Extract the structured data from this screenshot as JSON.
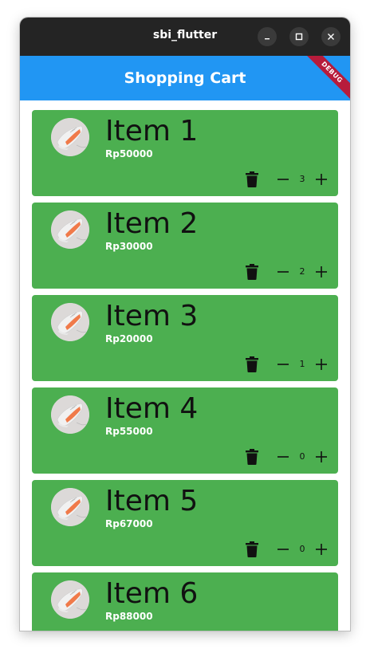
{
  "window": {
    "title": "sbi_flutter"
  },
  "appbar": {
    "title": "Shopping Cart",
    "debug_label": "DEBUG"
  },
  "colors": {
    "titlebar": "#242424",
    "appbar": "#2196f3",
    "card": "#4caf50",
    "debug_banner": "#b71c3c"
  },
  "cart": {
    "items": [
      {
        "name": "Item 1",
        "price": "Rp50000",
        "qty": "3"
      },
      {
        "name": "Item 2",
        "price": "Rp30000",
        "qty": "2"
      },
      {
        "name": "Item 3",
        "price": "Rp20000",
        "qty": "1"
      },
      {
        "name": "Item 4",
        "price": "Rp55000",
        "qty": "0"
      },
      {
        "name": "Item 5",
        "price": "Rp67000",
        "qty": "0"
      },
      {
        "name": "Item 6",
        "price": "Rp88000",
        "qty": ""
      }
    ]
  }
}
